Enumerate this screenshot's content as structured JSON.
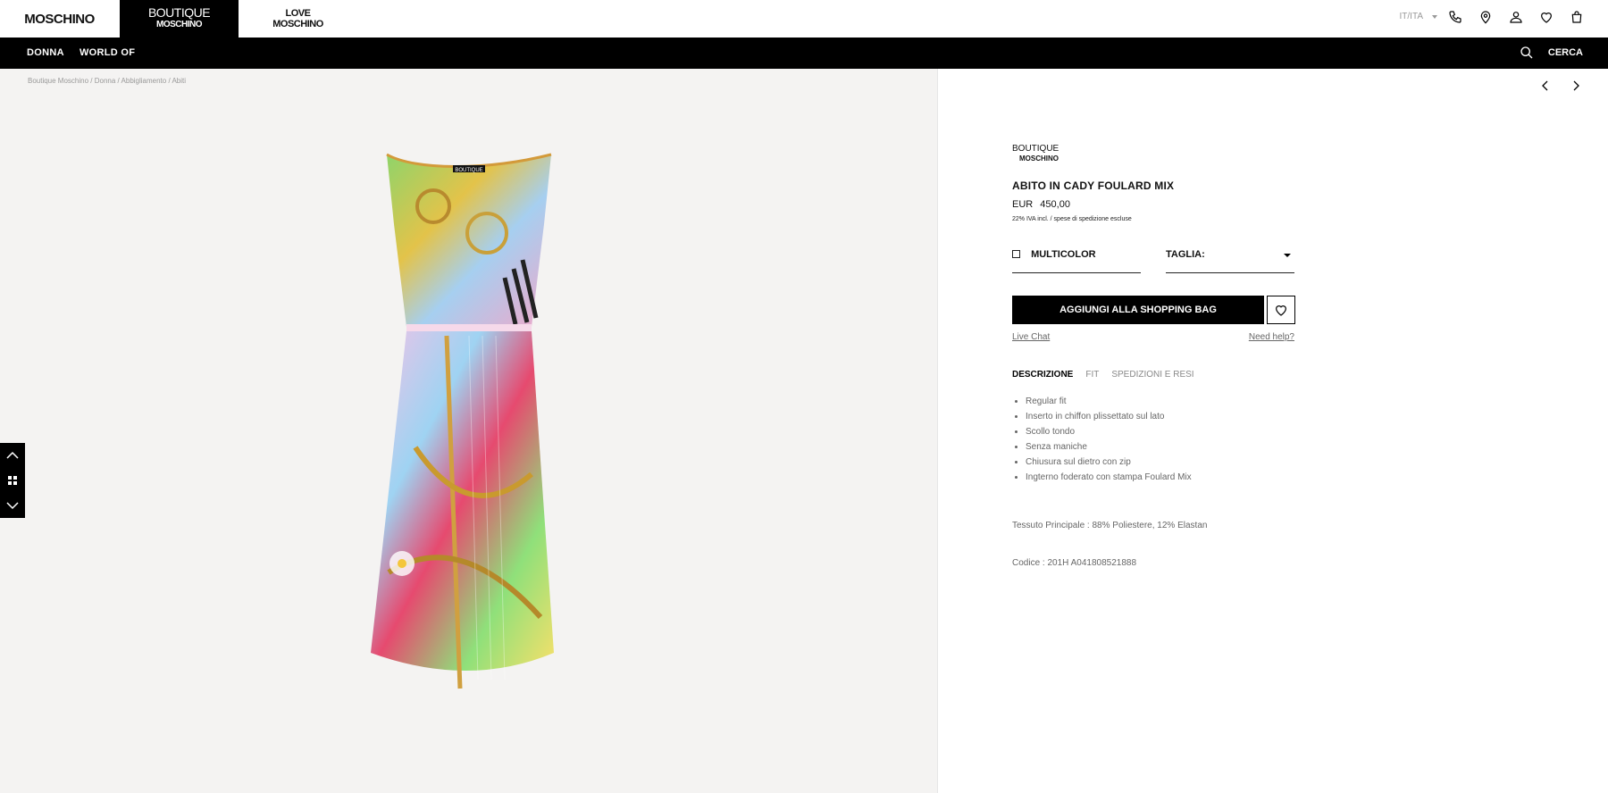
{
  "header": {
    "brands": [
      {
        "label": "MOSCHINO"
      },
      {
        "line1": "BOUTIQUE",
        "line2": "MOSCHINO"
      },
      {
        "line1": "LOVE",
        "line2": "MOSCHINO"
      }
    ],
    "language": "IT/ITA",
    "icons": [
      "phone-icon",
      "location-icon",
      "account-icon",
      "wishlist-icon",
      "bag-icon"
    ]
  },
  "nav": {
    "items": [
      "DONNA",
      "WORLD OF"
    ],
    "search_label": "CERCA"
  },
  "breadcrumb": [
    "Boutique Moschino",
    "Donna",
    "Abbigliamento",
    "Abiti"
  ],
  "product": {
    "brand_line1": "BOUTIQUE",
    "brand_line2": "MOSCHINO",
    "name": "ABITO IN CADY FOULARD MIX",
    "currency": "EUR",
    "price": "450,00",
    "vat_note": "22% IVA incl. / spese di spedizione escluse",
    "color_label": "MULTICOLOR",
    "size_label": "TAGLIA:",
    "add_to_bag": "AGGIUNGI ALLA SHOPPING BAG",
    "live_chat": "Live Chat",
    "need_help": "Need help?",
    "tabs": [
      "DESCRIZIONE",
      "FIT",
      "SPEDIZIONI E RESI"
    ],
    "description": [
      "Regular fit",
      "Inserto in chiffon plissettato sul lato",
      "Scollo tondo",
      "Senza maniche",
      "Chiusura sul dietro con zip",
      "Ingterno foderato con stampa Foulard Mix"
    ],
    "fabric": "Tessuto Principale : 88% Poliestere, 12% Elastan",
    "code": "Codice : 201H A041808521888",
    "label_tag": "BOUTIQUE"
  },
  "colors": {
    "accent": "#000000",
    "gallery_bg": "#f4f3f2"
  }
}
